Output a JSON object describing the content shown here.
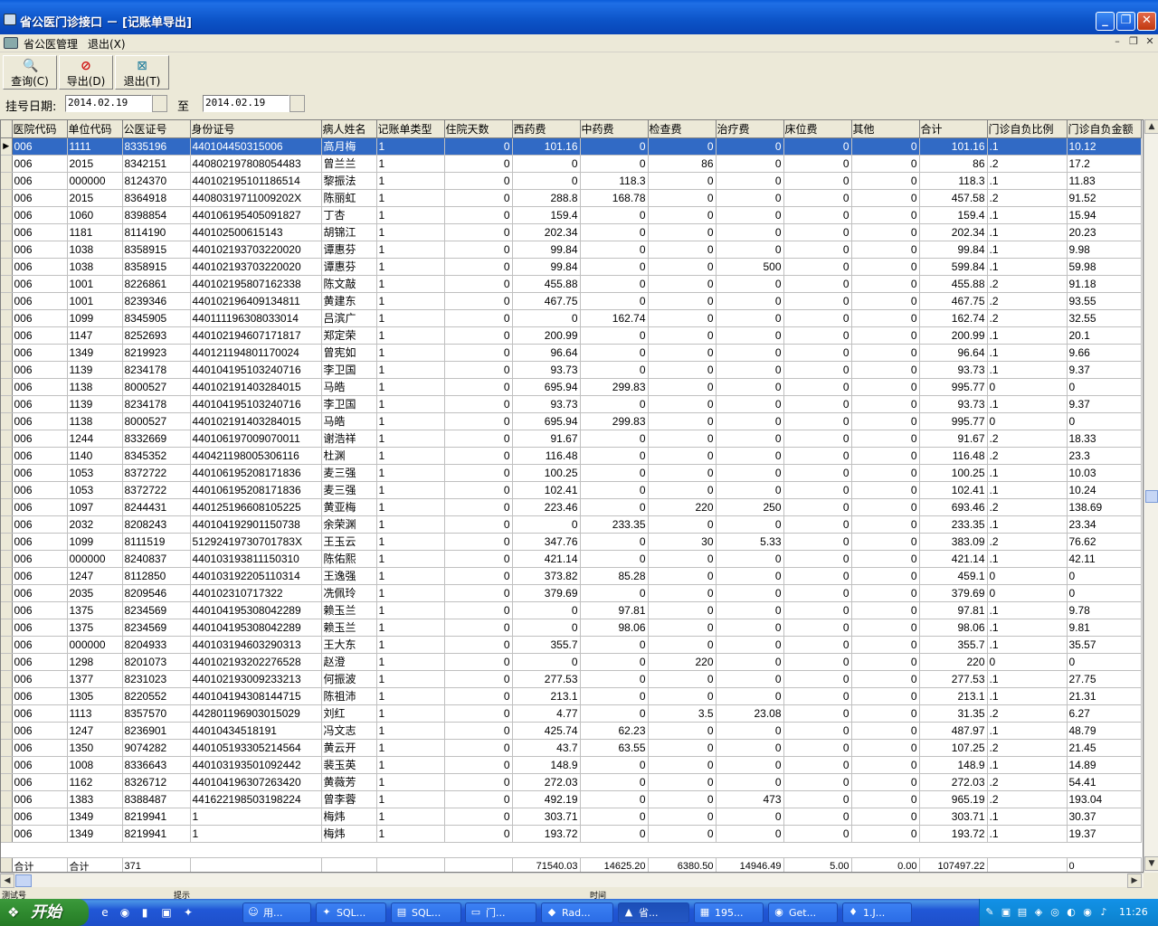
{
  "window": {
    "title": "省公医门诊接口 － [记账单导出]",
    "minimize": "_",
    "restore": "❐",
    "close": "✕"
  },
  "menu": {
    "items": [
      "省公医管理",
      "退出(X)"
    ],
    "mdi_min": "–",
    "mdi_restore": "❐",
    "mdi_close": "✕"
  },
  "toolbar": {
    "buttons": [
      {
        "label": "查询(C)",
        "icon": "magnifier-icon",
        "glyph": "🔍"
      },
      {
        "label": "导出(D)",
        "icon": "no-entry-icon",
        "glyph": "⊘"
      },
      {
        "label": "退出(T)",
        "icon": "exit-icon",
        "glyph": "⊠"
      }
    ]
  },
  "filter": {
    "label": "挂号日期:",
    "from": "2014.02.19",
    "to_label": "至",
    "to": "2014.02.19"
  },
  "table": {
    "columns": [
      "医院代码",
      "单位代码",
      "公医证号",
      "身份证号",
      "病人姓名",
      "记账单类型",
      "住院天数",
      "西药费",
      "中药费",
      "检查费",
      "治疗费",
      "床位费",
      "其他",
      "合计",
      "门诊自负比例",
      "门诊自负金额"
    ],
    "rows": [
      [
        "006",
        "1111",
        "8335196",
        "440104450315006",
        "高月梅",
        "1",
        "0",
        "101.16",
        "0",
        "0",
        "0",
        "0",
        "0",
        "101.16",
        ".1",
        "10.12"
      ],
      [
        "006",
        "2015",
        "8342151",
        "440802197808054483",
        "曾兰兰",
        "1",
        "0",
        "0",
        "0",
        "86",
        "0",
        "0",
        "0",
        "86",
        ".2",
        "17.2"
      ],
      [
        "006",
        "000000",
        "8124370",
        "440102195101186514",
        "黎振法",
        "1",
        "0",
        "0",
        "118.3",
        "0",
        "0",
        "0",
        "0",
        "118.3",
        ".1",
        "11.83"
      ],
      [
        "006",
        "2015",
        "8364918",
        "44080319711009202X",
        "陈丽虹",
        "1",
        "0",
        "288.8",
        "168.78",
        "0",
        "0",
        "0",
        "0",
        "457.58",
        ".2",
        "91.52"
      ],
      [
        "006",
        "1060",
        "8398854",
        "440106195405091827",
        "丁杏",
        "1",
        "0",
        "159.4",
        "0",
        "0",
        "0",
        "0",
        "0",
        "159.4",
        ".1",
        "15.94"
      ],
      [
        "006",
        "1181",
        "8114190",
        "440102500615143",
        "胡锦江",
        "1",
        "0",
        "202.34",
        "0",
        "0",
        "0",
        "0",
        "0",
        "202.34",
        ".1",
        "20.23"
      ],
      [
        "006",
        "1038",
        "8358915",
        "440102193703220020",
        "谭惠芬",
        "1",
        "0",
        "99.84",
        "0",
        "0",
        "0",
        "0",
        "0",
        "99.84",
        ".1",
        "9.98"
      ],
      [
        "006",
        "1038",
        "8358915",
        "440102193703220020",
        "谭惠芬",
        "1",
        "0",
        "99.84",
        "0",
        "0",
        "500",
        "0",
        "0",
        "599.84",
        ".1",
        "59.98"
      ],
      [
        "006",
        "1001",
        "8226861",
        "440102195807162338",
        "陈文敲",
        "1",
        "0",
        "455.88",
        "0",
        "0",
        "0",
        "0",
        "0",
        "455.88",
        ".2",
        "91.18"
      ],
      [
        "006",
        "1001",
        "8239346",
        "440102196409134811",
        "黄建东",
        "1",
        "0",
        "467.75",
        "0",
        "0",
        "0",
        "0",
        "0",
        "467.75",
        ".2",
        "93.55"
      ],
      [
        "006",
        "1099",
        "8345905",
        "440111196308033014",
        "吕滨广",
        "1",
        "0",
        "0",
        "162.74",
        "0",
        "0",
        "0",
        "0",
        "162.74",
        ".2",
        "32.55"
      ],
      [
        "006",
        "1147",
        "8252693",
        "440102194607171817",
        "郑定荣",
        "1",
        "0",
        "200.99",
        "0",
        "0",
        "0",
        "0",
        "0",
        "200.99",
        ".1",
        "20.1"
      ],
      [
        "006",
        "1349",
        "8219923",
        "440121194801170024",
        "曾宪如",
        "1",
        "0",
        "96.64",
        "0",
        "0",
        "0",
        "0",
        "0",
        "96.64",
        ".1",
        "9.66"
      ],
      [
        "006",
        "1139",
        "8234178",
        "440104195103240716",
        "李卫国",
        "1",
        "0",
        "93.73",
        "0",
        "0",
        "0",
        "0",
        "0",
        "93.73",
        ".1",
        "9.37"
      ],
      [
        "006",
        "1138",
        "8000527",
        "440102191403284015",
        "马皓",
        "1",
        "0",
        "695.94",
        "299.83",
        "0",
        "0",
        "0",
        "0",
        "995.77",
        "0",
        "0"
      ],
      [
        "006",
        "1139",
        "8234178",
        "440104195103240716",
        "李卫国",
        "1",
        "0",
        "93.73",
        "0",
        "0",
        "0",
        "0",
        "0",
        "93.73",
        ".1",
        "9.37"
      ],
      [
        "006",
        "1138",
        "8000527",
        "440102191403284015",
        "马皓",
        "1",
        "0",
        "695.94",
        "299.83",
        "0",
        "0",
        "0",
        "0",
        "995.77",
        "0",
        "0"
      ],
      [
        "006",
        "1244",
        "8332669",
        "440106197009070011",
        "谢浩祥",
        "1",
        "0",
        "91.67",
        "0",
        "0",
        "0",
        "0",
        "0",
        "91.67",
        ".2",
        "18.33"
      ],
      [
        "006",
        "1140",
        "8345352",
        "440421198005306116",
        "杜渊",
        "1",
        "0",
        "116.48",
        "0",
        "0",
        "0",
        "0",
        "0",
        "116.48",
        ".2",
        "23.3"
      ],
      [
        "006",
        "1053",
        "8372722",
        "440106195208171836",
        "麦三强",
        "1",
        "0",
        "100.25",
        "0",
        "0",
        "0",
        "0",
        "0",
        "100.25",
        ".1",
        "10.03"
      ],
      [
        "006",
        "1053",
        "8372722",
        "440106195208171836",
        "麦三强",
        "1",
        "0",
        "102.41",
        "0",
        "0",
        "0",
        "0",
        "0",
        "102.41",
        ".1",
        "10.24"
      ],
      [
        "006",
        "1097",
        "8244431",
        "440125196608105225",
        "黄亚梅",
        "1",
        "0",
        "223.46",
        "0",
        "220",
        "250",
        "0",
        "0",
        "693.46",
        ".2",
        "138.69"
      ],
      [
        "006",
        "2032",
        "8208243",
        "440104192901150738",
        "余荣渊",
        "1",
        "0",
        "0",
        "233.35",
        "0",
        "0",
        "0",
        "0",
        "233.35",
        ".1",
        "23.34"
      ],
      [
        "006",
        "1099",
        "8111519",
        "51292419730701783X",
        "王玉云",
        "1",
        "0",
        "347.76",
        "0",
        "30",
        "5.33",
        "0",
        "0",
        "383.09",
        ".2",
        "76.62"
      ],
      [
        "006",
        "000000",
        "8240837",
        "440103193811150310",
        "陈佑熙",
        "1",
        "0",
        "421.14",
        "0",
        "0",
        "0",
        "0",
        "0",
        "421.14",
        ".1",
        "42.11"
      ],
      [
        "006",
        "1247",
        "8112850",
        "440103192205110314",
        "王逸强",
        "1",
        "0",
        "373.82",
        "85.28",
        "0",
        "0",
        "0",
        "0",
        "459.1",
        "0",
        "0"
      ],
      [
        "006",
        "2035",
        "8209546",
        "440102310717322",
        "冼佩玲",
        "1",
        "0",
        "379.69",
        "0",
        "0",
        "0",
        "0",
        "0",
        "379.69",
        "0",
        "0"
      ],
      [
        "006",
        "1375",
        "8234569",
        "440104195308042289",
        "赖玉兰",
        "1",
        "0",
        "0",
        "97.81",
        "0",
        "0",
        "0",
        "0",
        "97.81",
        ".1",
        "9.78"
      ],
      [
        "006",
        "1375",
        "8234569",
        "440104195308042289",
        "赖玉兰",
        "1",
        "0",
        "0",
        "98.06",
        "0",
        "0",
        "0",
        "0",
        "98.06",
        ".1",
        "9.81"
      ],
      [
        "006",
        "000000",
        "8204933",
        "440103194603290313",
        "王大东",
        "1",
        "0",
        "355.7",
        "0",
        "0",
        "0",
        "0",
        "0",
        "355.7",
        ".1",
        "35.57"
      ],
      [
        "006",
        "1298",
        "8201073",
        "440102193202276528",
        "赵澄",
        "1",
        "0",
        "0",
        "0",
        "220",
        "0",
        "0",
        "0",
        "220",
        "0",
        "0"
      ],
      [
        "006",
        "1377",
        "8231023",
        "440102193009233213",
        "何振波",
        "1",
        "0",
        "277.53",
        "0",
        "0",
        "0",
        "0",
        "0",
        "277.53",
        ".1",
        "27.75"
      ],
      [
        "006",
        "1305",
        "8220552",
        "440104194308144715",
        "陈祖沛",
        "1",
        "0",
        "213.1",
        "0",
        "0",
        "0",
        "0",
        "0",
        "213.1",
        ".1",
        "21.31"
      ],
      [
        "006",
        "1113",
        "8357570",
        "442801196903015029",
        "刘红",
        "1",
        "0",
        "4.77",
        "0",
        "3.5",
        "23.08",
        "0",
        "0",
        "31.35",
        ".2",
        "6.27"
      ],
      [
        "006",
        "1247",
        "8236901",
        "44010434518191",
        "冯文志",
        "1",
        "0",
        "425.74",
        "62.23",
        "0",
        "0",
        "0",
        "0",
        "487.97",
        ".1",
        "48.79"
      ],
      [
        "006",
        "1350",
        "9074282",
        "440105193305214564",
        "黄云开",
        "1",
        "0",
        "43.7",
        "63.55",
        "0",
        "0",
        "0",
        "0",
        "107.25",
        ".2",
        "21.45"
      ],
      [
        "006",
        "1008",
        "8336643",
        "440103193501092442",
        "裴玉英",
        "1",
        "0",
        "148.9",
        "0",
        "0",
        "0",
        "0",
        "0",
        "148.9",
        ".1",
        "14.89"
      ],
      [
        "006",
        "1162",
        "8326712",
        "440104196307263420",
        "黄薇芳",
        "1",
        "0",
        "272.03",
        "0",
        "0",
        "0",
        "0",
        "0",
        "272.03",
        ".2",
        "54.41"
      ],
      [
        "006",
        "1383",
        "8388487",
        "441622198503198224",
        "曾李蓉",
        "1",
        "0",
        "492.19",
        "0",
        "0",
        "473",
        "0",
        "0",
        "965.19",
        ".2",
        "193.04"
      ],
      [
        "006",
        "1349",
        "8219941",
        "1",
        "梅炜",
        "1",
        "0",
        "303.71",
        "0",
        "0",
        "0",
        "0",
        "0",
        "303.71",
        ".1",
        "30.37"
      ],
      [
        "006",
        "1349",
        "8219941",
        "1",
        "梅炜",
        "1",
        "0",
        "193.72",
        "0",
        "0",
        "0",
        "0",
        "0",
        "193.72",
        ".1",
        "19.37"
      ]
    ],
    "totals": [
      "合计",
      "合计",
      "371",
      "",
      "",
      "",
      "",
      "71540.03",
      "14625.20",
      "6380.50",
      "14946.49",
      "5.00",
      "0.00",
      "107497.22",
      "",
      "0"
    ]
  },
  "statusbar": {
    "left": "测试号",
    "mid": "提示",
    "right": "时间"
  },
  "taskbar": {
    "start": "开始",
    "tasks": [
      {
        "label": "用...",
        "glyph": "☺"
      },
      {
        "label": "SQL...",
        "glyph": "✦"
      },
      {
        "label": "SQL...",
        "glyph": "▤"
      },
      {
        "label": "门...",
        "glyph": "▭"
      },
      {
        "label": "Rad...",
        "glyph": "◆"
      },
      {
        "label": "省...",
        "glyph": "▲"
      },
      {
        "label": "195...",
        "glyph": "▦"
      },
      {
        "label": "Get...",
        "glyph": "◉"
      },
      {
        "label": "1.J...",
        "glyph": "♦"
      }
    ],
    "clock": "11:26"
  }
}
